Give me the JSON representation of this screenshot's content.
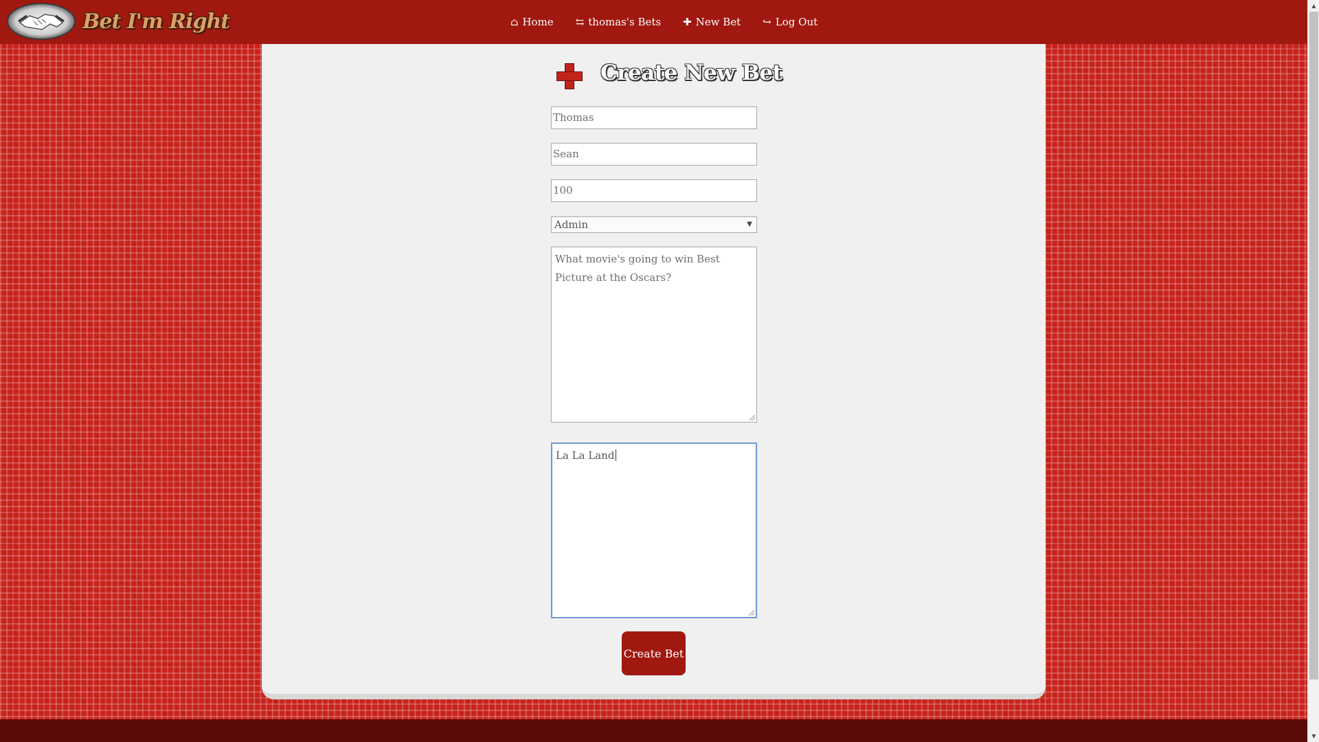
{
  "brand": {
    "name": "Bet I'm Right",
    "logo_icon": "handshake-icon"
  },
  "nav": {
    "items": [
      {
        "icon": "⌂",
        "icon_name": "home-icon",
        "label": "Home"
      },
      {
        "icon": "⇆",
        "icon_name": "exchange-icon",
        "label": "thomas's Bets"
      },
      {
        "icon": "✚",
        "icon_name": "plus-icon",
        "label": "New Bet"
      },
      {
        "icon": "↪",
        "icon_name": "sign-out-icon",
        "label": "Log Out"
      }
    ]
  },
  "form": {
    "title": "Create New Bet",
    "title_icon": "plus-icon",
    "creator_value": "Thomas",
    "opponent_value": "Sean",
    "amount_value": "100",
    "judge_selected": "Admin",
    "question_value": "What movie's going to win Best Picture at the Oscars?",
    "answer_value": "La La Land",
    "submit_label": "Create Bet"
  },
  "colors": {
    "nav_bg": "#a01810",
    "pattern_bg": "#c8231c",
    "button_bg": "#a01810",
    "footer_bg": "#5a0a07",
    "focus_border": "#6f96d8"
  }
}
